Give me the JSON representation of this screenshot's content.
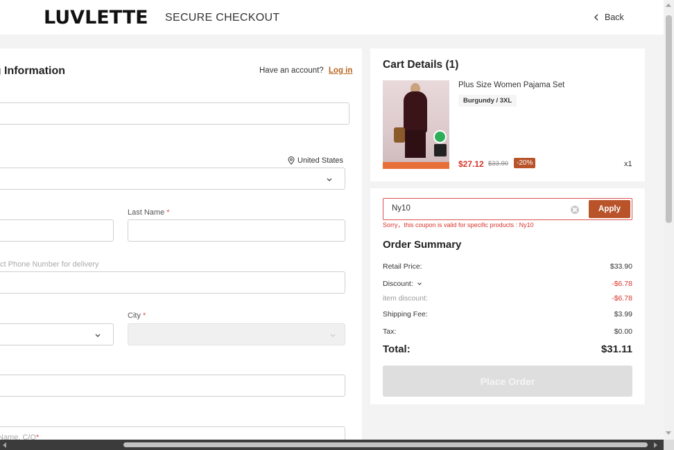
{
  "header": {
    "logo": "LUVLETTE",
    "title": "SECURE CHECKOUT",
    "back_label": "Back"
  },
  "shipping": {
    "title": "ng Information",
    "have_account": "Have an account?",
    "login_link": "Log in",
    "country": "United States",
    "last_name_label": "Last Name",
    "phone_placeholder": "ct Phone Number for delivery",
    "city_label": "City",
    "address_label_partial": "Name, C/O",
    "required_mark": "*"
  },
  "cart": {
    "title": "Cart Details (1)",
    "item": {
      "name": "Plus Size Women Pajama Set",
      "variant": "Burgundy / 3XL",
      "price": "$27.12",
      "original_price": "$33.90",
      "discount_pct": "-20%",
      "quantity": "x1"
    }
  },
  "coupon": {
    "value": "Ny10",
    "apply_label": "Apply",
    "error": "Sorry，this coupon is valid for specific products : Ny10"
  },
  "order_summary": {
    "title": "Order Summary",
    "retail_label": "Retail Price:",
    "retail_value": "$33.90",
    "discount_label": "Discount:",
    "discount_value": "-$6.78",
    "item_discount_label": "item discount:",
    "item_discount_value": "-$6.78",
    "shipping_label": "Shipping Fee:",
    "shipping_value": "$3.99",
    "tax_label": "Tax:",
    "tax_value": "$0.00",
    "total_label": "Total:",
    "total_value": "$31.11",
    "place_order": "Place Order"
  },
  "colors": {
    "accent": "#b8532a",
    "error": "#d6342c",
    "link": "#b8621b"
  }
}
